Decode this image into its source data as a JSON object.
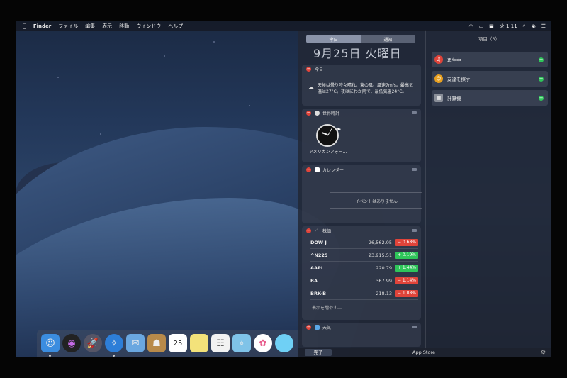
{
  "menubar": {
    "apple_icon": "apple-icon",
    "app_name": "Finder",
    "items": [
      "ファイル",
      "編集",
      "表示",
      "移動",
      "ウインドウ",
      "ヘルプ"
    ],
    "time": "火 1:11"
  },
  "notification_center": {
    "tabs": {
      "today": "今日",
      "notifications": "通知"
    },
    "date": "9月25日 火曜日",
    "widgets": {
      "weather_today": {
        "title": "今日",
        "text": "天候は曇り時々晴れ。東の風、風速7m/s。最高気温は27°C。夜はにわか雨で、最低気温24°C。"
      },
      "world_clock": {
        "title": "世界時計",
        "city": "アメリカンフォー…"
      },
      "calendar": {
        "title": "カレンダー",
        "empty": "イベントはありません"
      },
      "stocks": {
        "title": "株価",
        "rows": [
          {
            "symbol": "DOW J",
            "price": "26,562.05",
            "change": "− 0.68%",
            "color": "#e0443a"
          },
          {
            "symbol": "^N225",
            "price": "23,915.51",
            "change": "+ 0.19%",
            "color": "#2fc55a"
          },
          {
            "symbol": "AAPL",
            "price": "220.79",
            "change": "+ 1.44%",
            "color": "#2fc55a"
          },
          {
            "symbol": "BA",
            "price": "367.99",
            "change": "− 1.14%",
            "color": "#e0443a"
          },
          {
            "symbol": "BRK-B",
            "price": "218.13",
            "change": "− 1.08%",
            "color": "#e0443a"
          }
        ],
        "more": "表示を増やす…"
      },
      "weather": {
        "title": "天気"
      }
    },
    "right_panel": {
      "header": "項目（3）",
      "items": [
        {
          "label": "再生中",
          "color": "#e0443a"
        },
        {
          "label": "友達を探す",
          "color": "#e8a020"
        },
        {
          "label": "計算機",
          "color": "#8a8f99"
        }
      ]
    },
    "bottom": {
      "done": "完了",
      "app_store": "App Store"
    }
  },
  "dock": {
    "calendar_day": "25",
    "apps": [
      "finder-icon",
      "siri-icon",
      "launchpad-icon",
      "safari-icon",
      "mail-icon",
      "contacts-icon",
      "calendar-icon",
      "notes-icon",
      "reminders-icon",
      "maps-icon",
      "photos-icon",
      "messages-icon"
    ]
  }
}
